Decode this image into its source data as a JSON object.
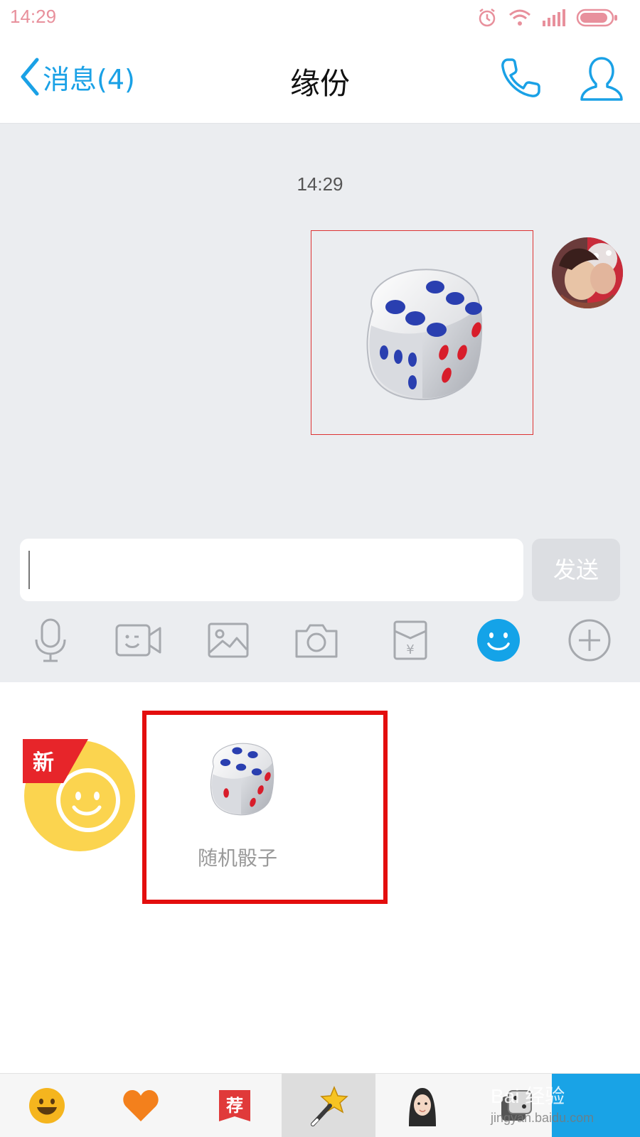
{
  "status_bar": {
    "time": "14:29"
  },
  "header": {
    "back_label": "消息(4)",
    "title": "缘份"
  },
  "chat": {
    "timestamp": "14:29"
  },
  "input": {
    "value": "",
    "send_label": "发送"
  },
  "panel": {
    "new_badge": "新",
    "dice_label": "随机骰子"
  },
  "watermark": {
    "main": "Bai 经验",
    "sub": "jingyan.baidu.com"
  },
  "colors": {
    "accent": "#1aa1e6",
    "highlight": "#e30e0e",
    "chat_bg": "#ebedf0",
    "emoji_yellow": "#fbd44f"
  }
}
